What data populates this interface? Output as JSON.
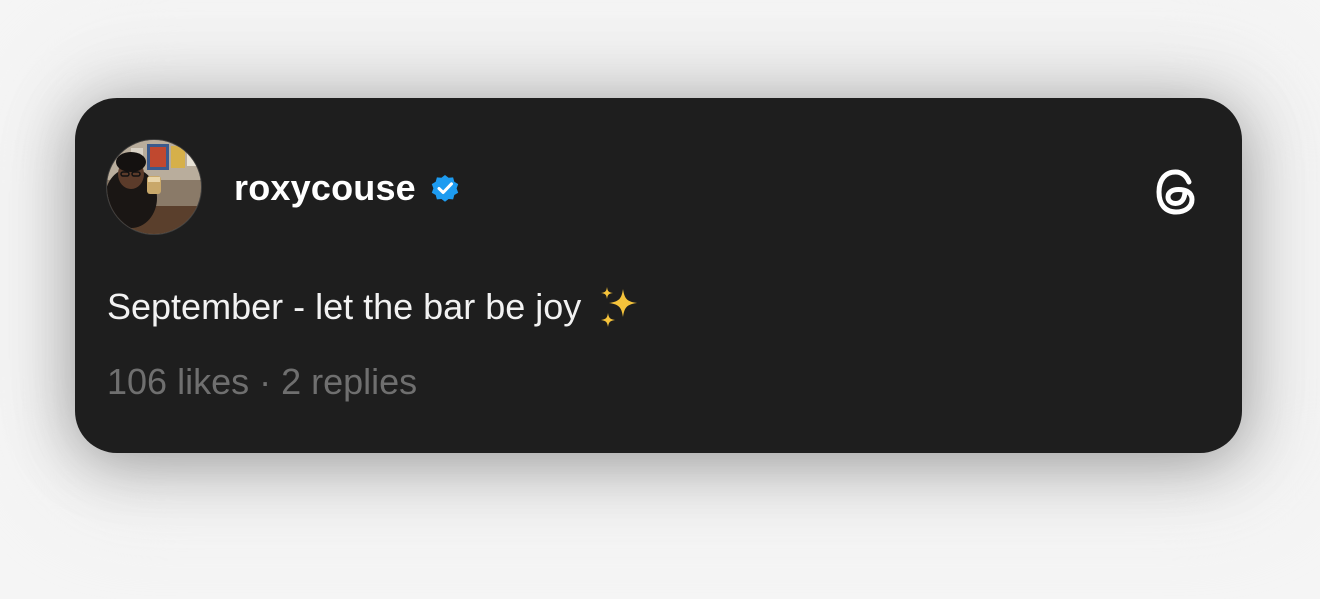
{
  "post": {
    "username": "roxycouse",
    "verified": true,
    "text": "September - let the bar be joy",
    "emoji": "sparkles-icon",
    "likes": "106 likes",
    "separator": "·",
    "replies": "2 replies"
  },
  "colors": {
    "card_bg": "#1e1e1e",
    "page_bg": "#f5f5f5",
    "verified_blue": "#1d9bf0",
    "meta_gray": "#6f6f6f",
    "sparkle_gold": "#f5c33b"
  }
}
